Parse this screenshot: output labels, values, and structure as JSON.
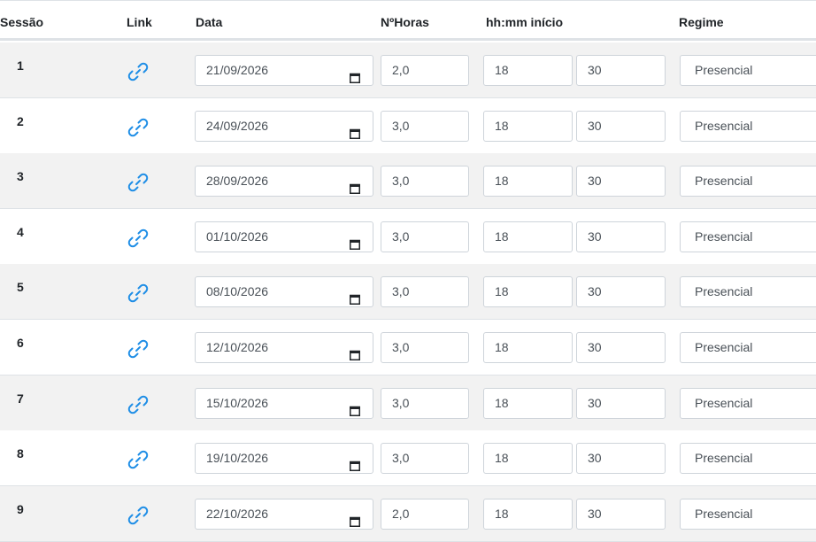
{
  "headers": {
    "sessao": "Sessão",
    "link": "Link",
    "data": "Data",
    "horas": "NºHoras",
    "inicio": "hh:mm início",
    "regime": "Regime"
  },
  "colors": {
    "link_blue": "#1f8ee6",
    "stripe": "#f2f2f2"
  },
  "icons": {
    "link": "link-icon",
    "calendar": "calendar-icon"
  },
  "rows": [
    {
      "sessao": "1",
      "data": "21/09/2026",
      "horas": "2,0",
      "hh": "18",
      "mm": "30",
      "regime": "Presencial"
    },
    {
      "sessao": "2",
      "data": "24/09/2026",
      "horas": "3,0",
      "hh": "18",
      "mm": "30",
      "regime": "Presencial"
    },
    {
      "sessao": "3",
      "data": "28/09/2026",
      "horas": "3,0",
      "hh": "18",
      "mm": "30",
      "regime": "Presencial"
    },
    {
      "sessao": "4",
      "data": "01/10/2026",
      "horas": "3,0",
      "hh": "18",
      "mm": "30",
      "regime": "Presencial"
    },
    {
      "sessao": "5",
      "data": "08/10/2026",
      "horas": "3,0",
      "hh": "18",
      "mm": "30",
      "regime": "Presencial"
    },
    {
      "sessao": "6",
      "data": "12/10/2026",
      "horas": "3,0",
      "hh": "18",
      "mm": "30",
      "regime": "Presencial"
    },
    {
      "sessao": "7",
      "data": "15/10/2026",
      "horas": "3,0",
      "hh": "18",
      "mm": "30",
      "regime": "Presencial"
    },
    {
      "sessao": "8",
      "data": "19/10/2026",
      "horas": "3,0",
      "hh": "18",
      "mm": "30",
      "regime": "Presencial"
    },
    {
      "sessao": "9",
      "data": "22/10/2026",
      "horas": "2,0",
      "hh": "18",
      "mm": "30",
      "regime": "Presencial"
    }
  ]
}
